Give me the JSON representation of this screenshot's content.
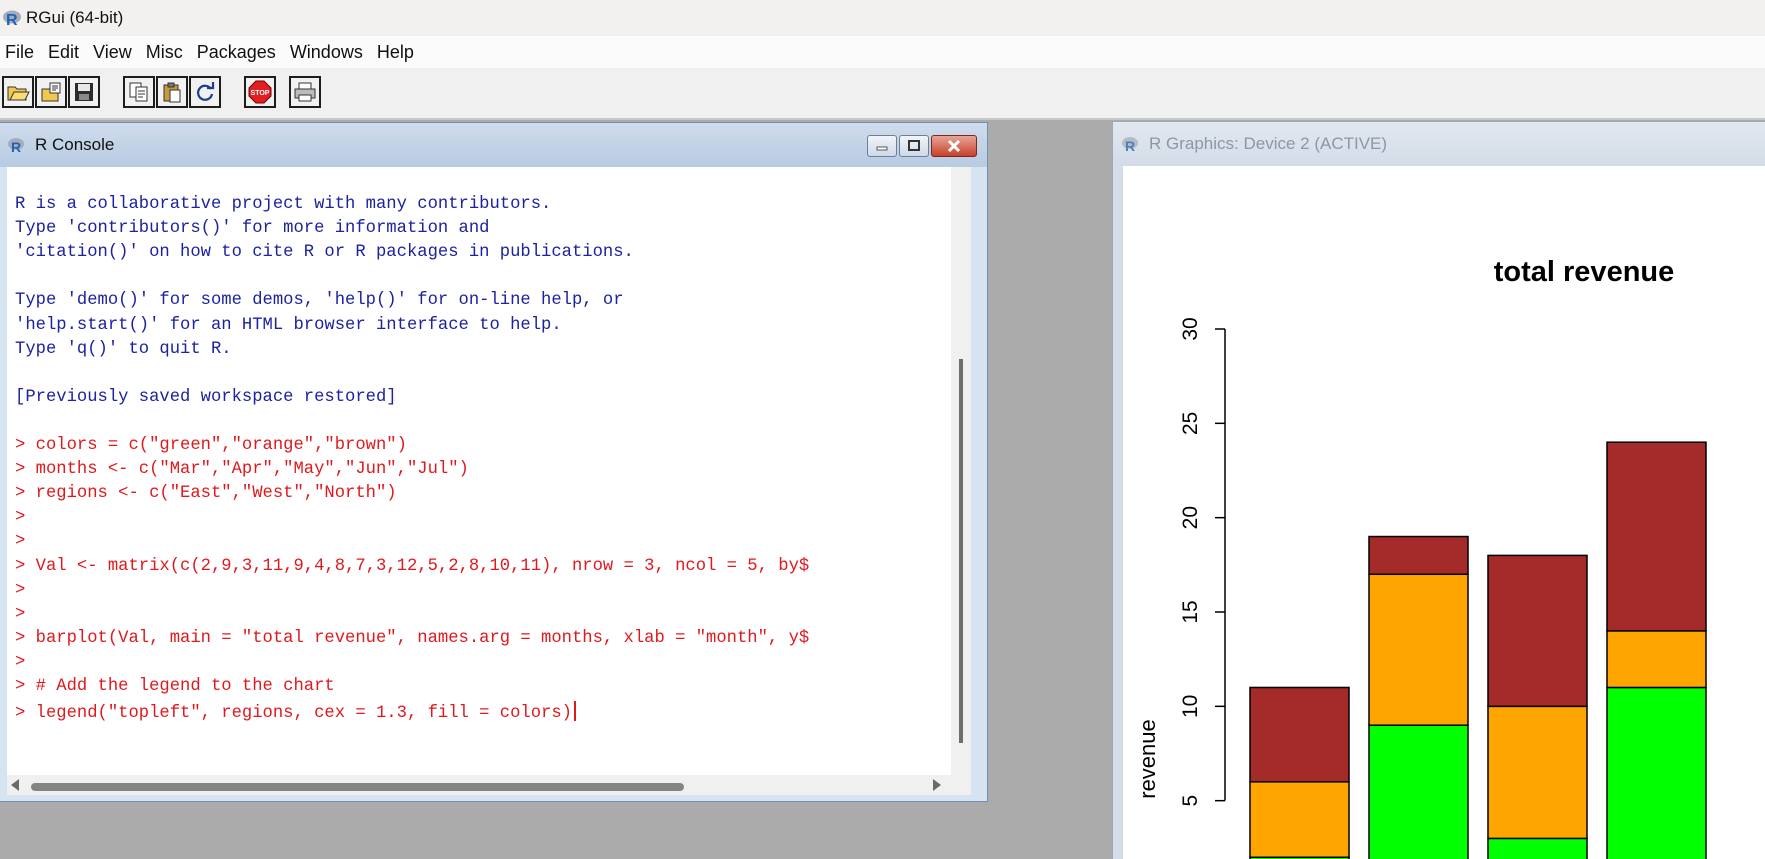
{
  "app": {
    "title": "RGui (64-bit)"
  },
  "menu": [
    "File",
    "Edit",
    "View",
    "Misc",
    "Packages",
    "Windows",
    "Help"
  ],
  "toolbar": {
    "buttons": [
      "open-script-icon",
      "load-workspace-icon",
      "save-icon",
      "copy-icon",
      "paste-icon",
      "refresh-icon",
      "stop-icon",
      "print-icon"
    ]
  },
  "console": {
    "title": "R Console",
    "lines": [
      {
        "type": "out",
        "text": "R is a collaborative project with many contributors."
      },
      {
        "type": "out",
        "text": "Type 'contributors()' for more information and"
      },
      {
        "type": "out",
        "text": "'citation()' on how to cite R or R packages in publications."
      },
      {
        "type": "blank",
        "text": ""
      },
      {
        "type": "out",
        "text": "Type 'demo()' for some demos, 'help()' for on-line help, or"
      },
      {
        "type": "out",
        "text": "'help.start()' for an HTML browser interface to help."
      },
      {
        "type": "out",
        "text": "Type 'q()' to quit R."
      },
      {
        "type": "blank",
        "text": ""
      },
      {
        "type": "out",
        "text": "[Previously saved workspace restored]"
      },
      {
        "type": "blank",
        "text": ""
      },
      {
        "type": "in",
        "text": "> colors = c(\"green\",\"orange\",\"brown\")"
      },
      {
        "type": "in",
        "text": "> months <- c(\"Mar\",\"Apr\",\"May\",\"Jun\",\"Jul\")"
      },
      {
        "type": "in",
        "text": "> regions <- c(\"East\",\"West\",\"North\")"
      },
      {
        "type": "in",
        "text": ">"
      },
      {
        "type": "in",
        "text": ">"
      },
      {
        "type": "in",
        "text": "> Val <- matrix(c(2,9,3,11,9,4,8,7,3,12,5,2,8,10,11), nrow = 3, ncol = 5, by$"
      },
      {
        "type": "in",
        "text": ">"
      },
      {
        "type": "in",
        "text": ">"
      },
      {
        "type": "in",
        "text": "> barplot(Val, main = \"total revenue\", names.arg = months, xlab = \"month\", y$"
      },
      {
        "type": "in",
        "text": ">"
      },
      {
        "type": "in",
        "text": "> # Add the legend to the chart"
      },
      {
        "type": "in",
        "text": "> legend(\"topleft\", regions, cex = 1.3, fill = colors)"
      }
    ]
  },
  "graphics": {
    "title": "R Graphics: Device 2 (ACTIVE)"
  },
  "chart_data": {
    "type": "bar",
    "stacked": true,
    "title": "total revenue",
    "ylabel": "revenue",
    "xlabel": "",
    "ylim": [
      0,
      30
    ],
    "yticks": [
      "5",
      "10",
      "15",
      "20",
      "25",
      "30"
    ],
    "series": [
      {
        "name": "",
        "color": "#00ff00",
        "values": [
          2,
          9,
          3,
          11
        ]
      },
      {
        "name": "",
        "color": "#ffa500",
        "values": [
          4,
          8,
          7,
          3
        ]
      },
      {
        "name": "",
        "color": "#a52a2a",
        "values": [
          5,
          2,
          8,
          10
        ]
      }
    ]
  }
}
